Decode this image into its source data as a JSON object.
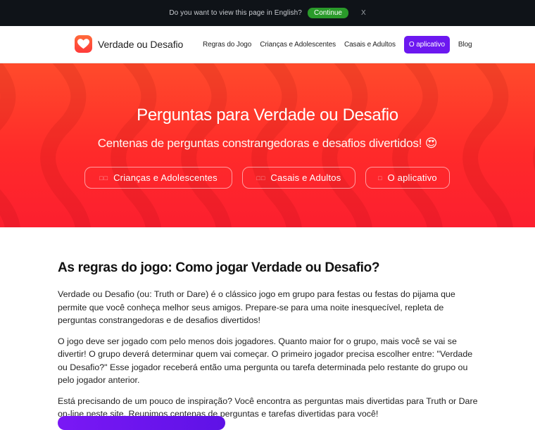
{
  "language_banner": {
    "prompt": "Do you want to view this page in English?",
    "continue_label": "Continue",
    "close_label": "X"
  },
  "navbar": {
    "brand_name": "Verdade ou Desafio",
    "links": [
      {
        "label": "Regras do Jogo"
      },
      {
        "label": "Crianças e Adolescentes"
      },
      {
        "label": "Casais e Adultos"
      },
      {
        "label": "O aplicativo"
      },
      {
        "label": "Blog"
      }
    ]
  },
  "hero": {
    "title": "Perguntas para Verdade ou Desafio",
    "subtitle": "Centenas de perguntas constrangedoras e desafios divertidos! 😍",
    "buttons": [
      {
        "glyph": "□□",
        "label": "Crianças e Adolescentes"
      },
      {
        "glyph": "□□",
        "label": "Casais e Adultos"
      },
      {
        "glyph": "□",
        "label": "O aplicativo"
      }
    ]
  },
  "content": {
    "heading": "As regras do jogo: Como jogar Verdade ou Desafio?",
    "paragraphs": [
      "Verdade ou Desafio (ou: Truth or Dare) é o clássico jogo em grupo para festas ou festas do pijama que permite que você conheça melhor seus amigos. Prepare-se para uma noite inesquecível, repleta de perguntas constrangedoras e de desafios divertidos!",
      "O jogo deve ser jogado com pelo menos dois jogadores. Quanto maior for o grupo, mais você se vai se divertir! O grupo deverá determinar quem vai começar. O primeiro jogador precisa escolher entre: \"Verdade ou Desafio?\" Esse jogador receberá então uma pergunta ou tarefa determinada pelo restante do grupo ou pelo jogador anterior.",
      "Está precisando de um pouco de inspiração? Você encontra as perguntas mais divertidas para Truth or Dare on-line neste site. Reunimos centenas de perguntas e tarefas divertidas para você!"
    ]
  },
  "colors": {
    "accent_purple": "#6c18f0",
    "hero_red": "#ff2a2a",
    "banner_dark": "#0f1318",
    "continue_green": "#2a9a2a"
  },
  "icons": {
    "brand": "heart-icon"
  }
}
